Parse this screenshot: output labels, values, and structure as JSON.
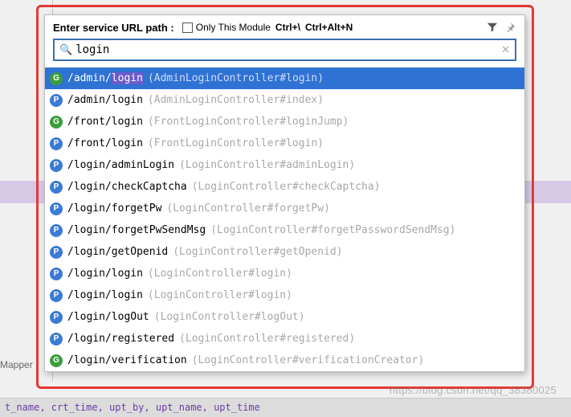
{
  "header": {
    "label": "Enter service URL path :",
    "onlyModuleLabel": "Only This Module",
    "shortcut1": "Ctrl+\\",
    "shortcut2": "Ctrl+Alt+N"
  },
  "search": {
    "value": "login"
  },
  "highlight": "login",
  "items": [
    {
      "method": "G",
      "path": "/admin/login",
      "desc": "(AdminLoginController#login)",
      "selected": true
    },
    {
      "method": "P",
      "path": "/admin/login",
      "desc": "(AdminLoginController#index)"
    },
    {
      "method": "G",
      "path": "/front/login",
      "desc": "(FrontLoginController#loginJump)"
    },
    {
      "method": "P",
      "path": "/front/login",
      "desc": "(FrontLoginController#login)"
    },
    {
      "method": "P",
      "path": "/login/adminLogin",
      "desc": "(LoginController#adminLogin)"
    },
    {
      "method": "P",
      "path": "/login/checkCaptcha",
      "desc": "(LoginController#checkCaptcha)"
    },
    {
      "method": "P",
      "path": "/login/forgetPw",
      "desc": "(LoginController#forgetPw)"
    },
    {
      "method": "P",
      "path": "/login/forgetPwSendMsg",
      "desc": "(LoginController#forgetPasswordSendMsg)"
    },
    {
      "method": "P",
      "path": "/login/getOpenid",
      "desc": "(LoginController#getOpenid)"
    },
    {
      "method": "P",
      "path": "/login/login",
      "desc": "(LoginController#login)"
    },
    {
      "method": "P",
      "path": "/login/login",
      "desc": "(LoginController#login)"
    },
    {
      "method": "P",
      "path": "/login/logOut",
      "desc": "(LoginController#logOut)"
    },
    {
      "method": "P",
      "path": "/login/registered",
      "desc": "(LoginController#registered)"
    },
    {
      "method": "G",
      "path": "/login/verification",
      "desc": "(LoginController#verificationCreator)"
    }
  ],
  "sideLabel": "Mapper",
  "bottomText": "t_name, crt_time, upt_by, upt_name, upt_time",
  "watermark": "https://blog.csdn.net/qq_38380025"
}
